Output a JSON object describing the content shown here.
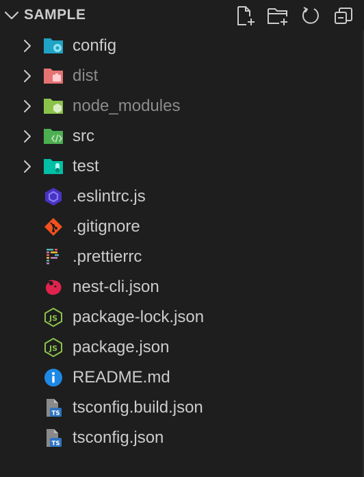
{
  "explorer": {
    "title": "SAMPLE",
    "actions": [
      {
        "name": "new-file-button",
        "icon": "new-file-icon"
      },
      {
        "name": "new-folder-button",
        "icon": "new-folder-icon"
      },
      {
        "name": "refresh-button",
        "icon": "refresh-icon"
      },
      {
        "name": "collapse-all-button",
        "icon": "collapse-all-icon"
      }
    ],
    "items": [
      {
        "label": "config",
        "type": "folder",
        "icon": "folder-config-icon",
        "dim": false
      },
      {
        "label": "dist",
        "type": "folder",
        "icon": "folder-dist-icon",
        "dim": true
      },
      {
        "label": "node_modules",
        "type": "folder",
        "icon": "folder-node-icon",
        "dim": true
      },
      {
        "label": "src",
        "type": "folder",
        "icon": "folder-src-icon",
        "dim": false
      },
      {
        "label": "test",
        "type": "folder",
        "icon": "folder-test-icon",
        "dim": false
      },
      {
        "label": ".eslintrc.js",
        "type": "file",
        "icon": "eslint-icon",
        "dim": false
      },
      {
        "label": ".gitignore",
        "type": "file",
        "icon": "git-icon",
        "dim": false
      },
      {
        "label": ".prettierrc",
        "type": "file",
        "icon": "prettier-icon",
        "dim": false
      },
      {
        "label": "nest-cli.json",
        "type": "file",
        "icon": "nestjs-icon",
        "dim": false
      },
      {
        "label": "package-lock.json",
        "type": "file",
        "icon": "nodejs-icon",
        "dim": false
      },
      {
        "label": "package.json",
        "type": "file",
        "icon": "nodejs-icon",
        "dim": false
      },
      {
        "label": "README.md",
        "type": "file",
        "icon": "info-icon",
        "dim": false
      },
      {
        "label": "tsconfig.build.json",
        "type": "file",
        "icon": "tsconfig-icon",
        "dim": false
      },
      {
        "label": "tsconfig.json",
        "type": "file",
        "icon": "tsconfig-icon",
        "dim": false
      }
    ]
  },
  "colors": {
    "background": "#1e1e1e",
    "text": "#cccccc",
    "text_dim": "#8c8c8c",
    "folder_config": "#20a3c5",
    "folder_dist": "#e57373",
    "folder_node": "#8bc34a",
    "folder_src": "#4caf50",
    "folder_test": "#00bfa5",
    "eslint": "#4b32c3",
    "git": "#f4511e",
    "nest": "#e0234e",
    "node": "#8bc34a",
    "info": "#1e88e5",
    "ts": "#2f74c0"
  }
}
